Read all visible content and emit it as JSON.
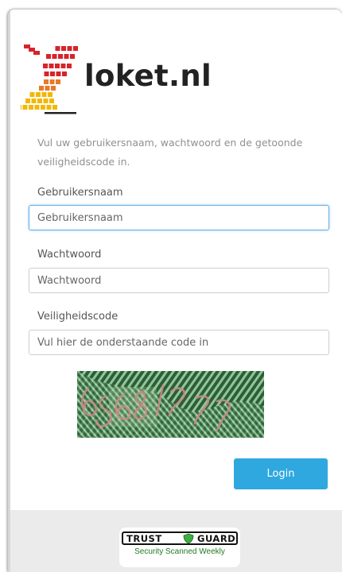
{
  "brand": {
    "name": "loket.nl",
    "colors": {
      "red": "#d8232a",
      "orange": "#e8792a",
      "yellow": "#f2b705",
      "text": "#222222"
    }
  },
  "intro_text": "Vul uw gebruikersnaam, wachtwoord en de getoonde veiligheidscode in.",
  "form": {
    "username": {
      "label": "Gebruikersnaam",
      "placeholder": "Gebruikersnaam",
      "value": ""
    },
    "password": {
      "label": "Wachtwoord",
      "placeholder": "Wachtwoord",
      "value": ""
    },
    "security_code": {
      "label": "Veiligheidscode",
      "placeholder": "Vul hier de onderstaande code in",
      "value": ""
    },
    "captcha": {
      "icon": "captcha-image"
    },
    "submit_label": "Login",
    "accent_color": "#2ea8df"
  },
  "footer": {
    "badge": {
      "word1": "TRUST",
      "word2": "GUARD",
      "subtitle": "Security Scanned Weekly",
      "icon": "shield-icon"
    }
  }
}
